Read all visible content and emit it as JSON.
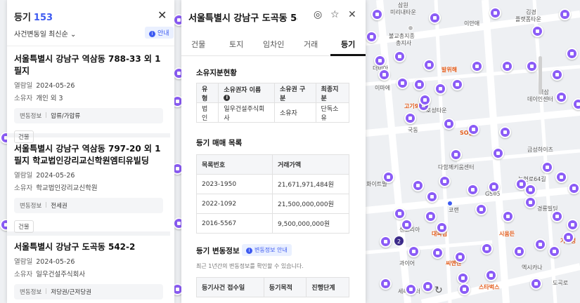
{
  "list": {
    "title": "등기",
    "count": "153",
    "close_icon": "close-icon",
    "sort_label": "사건변동일 최신순",
    "info_label": "안내",
    "items": [
      {
        "addr": "서울특별시 강남구 역삼동 788-33 외 1필지",
        "date_k": "열람일",
        "date": "2024-05-26",
        "owner_k": "소유자",
        "owner": "개인 외 3",
        "change_k": "변동정보",
        "change": "압류/가압류",
        "tag": "건물"
      },
      {
        "addr": "서울특별시 강남구 역삼동 797-20 외 1필지 학교법인강리교신학원엠티유빌딩",
        "date_k": "열람일",
        "date": "2024-05-26",
        "owner_k": "소유자",
        "owner": "학교법인강리교신학원",
        "change_k": "변동정보",
        "change": "전세권",
        "tag": "건물"
      },
      {
        "addr": "서울특별시 강남구 도곡동 542-2",
        "date_k": "열람일",
        "date": "2024-05-26",
        "owner_k": "소유자",
        "owner": "일우건설주식회사",
        "change_k": "변동정보",
        "change": "저당권/근저당권",
        "tag": ""
      }
    ]
  },
  "detail": {
    "title": "서울특별시 강남구 도곡동 54...",
    "tabs": [
      "건물",
      "토지",
      "임차인",
      "거래",
      "등기"
    ],
    "active_tab": "등기",
    "ownership": {
      "title": "소유지분현황",
      "headers": [
        "유형",
        "소유권자 이름",
        "소유권 구분",
        "최종지분"
      ],
      "rows": [
        [
          "법인",
          "일우건설주식회사",
          "소유자",
          "단독소유"
        ]
      ]
    },
    "sales": {
      "title": "등기 매매 목록",
      "headers": [
        "목록번호",
        "거래가액"
      ],
      "rows": [
        [
          "2023-1950",
          "21,671,971,484원"
        ],
        [
          "2022-1092",
          "21,500,000,000원"
        ],
        [
          "2016-5567",
          "9,500,000,000원"
        ]
      ]
    },
    "changes": {
      "title": "등기 변동정보",
      "badge": "변동정보 안내",
      "note": "최근 1년간의 변동정보를 확인할 수 있습니다.",
      "headers": [
        "등기사건 접수일",
        "등기목적",
        "진행단계"
      ]
    }
  },
  "map": {
    "labels": [
      "삼원",
      "미리내타운",
      "이안애",
      "김경",
      "플랫폼타운",
      "불교총지종",
      "총지사",
      "역삼",
      "데이인센터",
      "고기92",
      "호성타운",
      "국동",
      "SO골",
      "금성하이츠",
      "다함께키움센터",
      "논현로64길",
      "화이트빌",
      "GS25",
      "경룡빌딩",
      "코랜",
      "센코리아",
      "대파집",
      "시움든",
      "가아정",
      "씨앤앤",
      "스타벅스",
      "엑시카나",
      "세리 센터",
      "도곡로",
      "더미아",
      "이마에",
      "발위해",
      "과이어"
    ],
    "cluster": "2",
    "colors": {
      "pin": "#8b5cf6",
      "accent": "#3d5af1"
    }
  }
}
